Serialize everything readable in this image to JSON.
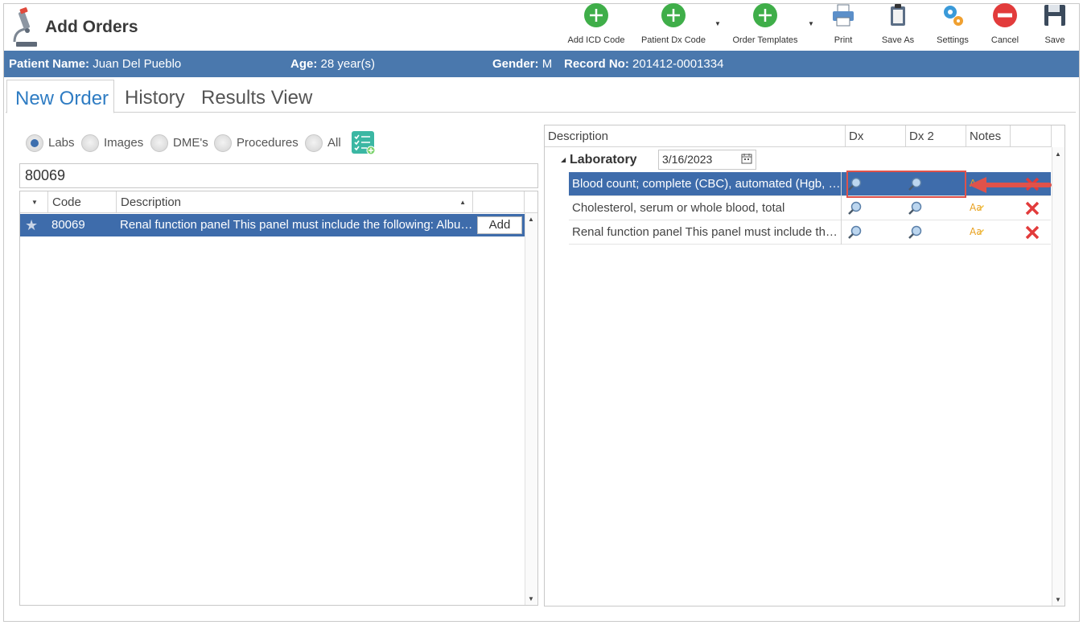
{
  "header": {
    "title": "Add Orders"
  },
  "toolbar": {
    "add_icd": "Add ICD Code",
    "patient_dx": "Patient Dx Code",
    "order_templates": "Order Templates",
    "print": "Print",
    "save_as": "Save As",
    "settings": "Settings",
    "cancel": "Cancel",
    "save": "Save"
  },
  "patient": {
    "name_label": "Patient Name:",
    "name": "Juan Del Pueblo",
    "age_label": "Age:",
    "age": "28 year(s)",
    "gender_label": "Gender:",
    "gender": "M",
    "record_label": "Record No:",
    "record": "201412-0001334"
  },
  "tabs": [
    "New Order",
    "History",
    "Results View"
  ],
  "filters": {
    "labs": "Labs",
    "images": "Images",
    "dmes": "DME's",
    "procedures": "Procedures",
    "all": "All",
    "selected": "Labs"
  },
  "search": {
    "value": "80069"
  },
  "left_grid": {
    "columns": {
      "code": "Code",
      "description": "Description"
    },
    "rows": [
      {
        "code": "80069",
        "description": "Renal function panel This panel must include the following: Albumin",
        "action": "Add"
      }
    ]
  },
  "right_grid": {
    "columns": {
      "description": "Description",
      "dx": "Dx",
      "dx2": "Dx 2",
      "notes": "Notes"
    },
    "group": {
      "name": "Laboratory",
      "date": "3/16/2023"
    },
    "rows": [
      {
        "description": "Blood count; complete (CBC), automated (Hgb, Hct, RBC, WBC and platelet count)"
      },
      {
        "description": "Cholesterol, serum or whole blood, total"
      },
      {
        "description": "Renal function panel This panel must include the following: Albumin"
      }
    ]
  },
  "colors": {
    "header_bar": "#4a78ad",
    "selected_row": "#3e6cab",
    "active_tab": "#2e7cc3",
    "annotation": "#e0524a"
  }
}
